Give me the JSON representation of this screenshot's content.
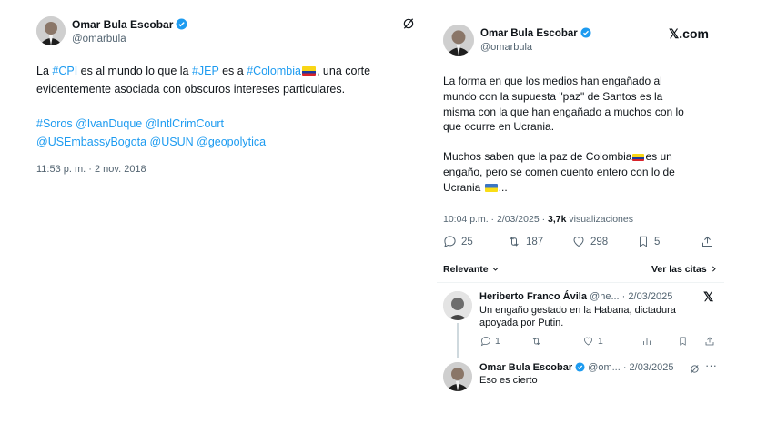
{
  "left_tweet": {
    "name": "Omar Bula Escobar",
    "handle": "@omarbula",
    "line1": {
      "pre": "La ",
      "tag1": "#CPI",
      "mid1": " es al mundo lo que la ",
      "tag2": "#JEP",
      "mid2": " es a ",
      "tag3": "#Colombia",
      "post": ", una corte"
    },
    "line2": "evidentemente asociada con obscuros intereses particulares.",
    "tags_line1": "#Soros @IvanDuque @IntlCrimCourt",
    "tags_line2": "@USEmbassyBogota @USUN @geopolytica",
    "timestamp": "11:53 p. m. · 2 nov. 2018"
  },
  "right_post": {
    "name": "Omar Bula Escobar",
    "handle": "@omarbula",
    "brand": "𝕏.com",
    "para1": [
      "La forma en que los medios han engañado al",
      "mundo con la supuesta \"paz\" de Santos es la",
      "misma con la que han engañado a muchos con lo",
      "que ocurre en Ucrania."
    ],
    "para2_line1_pre": "Muchos saben que la paz de Colombia",
    "para2_line1_post": "es un",
    "para2_line2": "engaño, pero se comen cuento entero con lo de",
    "para2_line3_pre": "Ucrania ",
    "para2_line3_post": "...",
    "meta_time": "10:04 p.m. · 2/03/2025 · ",
    "meta_views": "3,7k",
    "meta_views_label": " visualizaciones",
    "stats": {
      "replies": "25",
      "reposts": "187",
      "likes": "298",
      "bookmarks": "5"
    },
    "sort_label": "Relevante",
    "quotes_link": "Ver las citas"
  },
  "replies": [
    {
      "name": "Heriberto Franco Ávila",
      "meta": "@he... · 2/03/2025",
      "text_line1": "Un engaño gestado en la Habana, dictadura",
      "text_line2": "apoyada por Putin.",
      "replies": "1",
      "likes": "1"
    },
    {
      "name": "Omar Bula Escobar",
      "meta": "@om... · 2/03/2025",
      "text_line1": "Eso es cierto"
    }
  ],
  "colors": {
    "link": "#1d9bf0",
    "text": "#0f1419",
    "muted": "#536471",
    "verified": "#1d9bf0"
  }
}
